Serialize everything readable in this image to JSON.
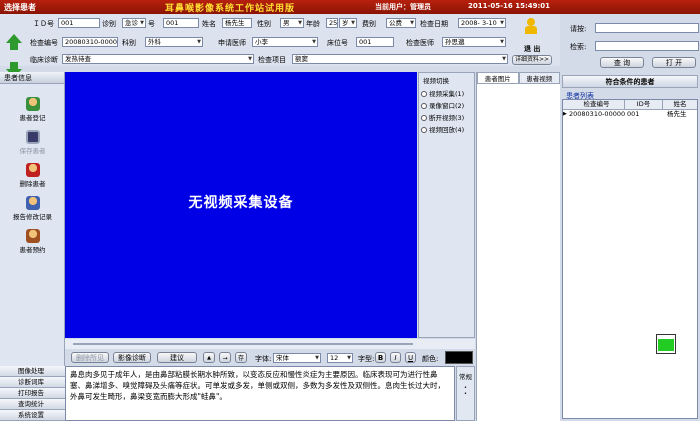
{
  "titlebar": {
    "left": "选择患者",
    "title": "耳鼻喉影像系统工作站试用版",
    "user": "当前用户：管理员",
    "datetime": "2011-05-16 15:49:01"
  },
  "form": {
    "id_label": "ＩＤ号",
    "id_value": "001",
    "visit_label": "诊别",
    "visit_value": "急诊",
    "no_label": "号",
    "no_value": "001",
    "name_label": "姓名",
    "name_value": "杨先生",
    "sex_label": "性别",
    "sex_value": "男",
    "age_label": "年龄",
    "age_value": "25",
    "age_unit": "岁",
    "fee_label": "费别",
    "fee_value": "公费",
    "date_label": "检查日期",
    "date_value": "2008- 3-10",
    "exam_no_label": "检查编号",
    "exam_no_value": "20080310-000001",
    "dept_label": "科别",
    "dept_value": "外科",
    "doctor_label": "申请医师",
    "doctor_value": "小李",
    "bed_label": "床位号",
    "bed_value": "001",
    "checker_label": "检查医师",
    "checker_value": "孙思邈",
    "clinical_label": "临床诊断",
    "clinical_value": "发热待查",
    "item_label": "检查项目",
    "item_value": "额窦"
  },
  "exit": {
    "label": "退 出",
    "detail": "详细资料>>"
  },
  "search": {
    "phone_label": "请按:",
    "check_label": "检索:",
    "query_btn": "查 询",
    "open_btn": "打 开",
    "result_title": "符合条件的患者",
    "list_label": "患者列表",
    "columns": [
      "检查编号",
      "ID号",
      "姓名"
    ],
    "rows": [
      [
        "20080310-000001",
        "001",
        "杨先生"
      ]
    ]
  },
  "leftnav": {
    "header": "患者信息",
    "items": [
      "患者登记",
      "保存患者",
      "删除患者",
      "报告修改记录",
      "患者预约"
    ]
  },
  "video": {
    "message": "无视频采集设备"
  },
  "vswitch": {
    "title": "视频切换",
    "options": [
      "视频采集(1)",
      "录像窗口(2)",
      "断开视频(3)",
      "视频回放(4)"
    ]
  },
  "middle_tabs": [
    "患者图片",
    "患者视频"
  ],
  "toolbar2": {
    "btn_all": "删除所见",
    "btn_diag": "影像诊断",
    "btn_suggest": "建议",
    "btn_save": "存",
    "font_label": "字体:",
    "font_value": "宋体",
    "size_value": "12",
    "size_label": "字型:",
    "bold": "B",
    "italic": "I",
    "underline": "U",
    "color_label": "颜色:"
  },
  "report_text": "鼻息肉多见于成年人，是由鼻部粘膜长期水肿所致，以变态反应和慢性炎症为主要原因。临床表现可为进行性鼻塞、鼻涕增多、嗅觉障碍及头痛等症状。可单发或多发，单侧或双侧，多数为多发性及双侧性。息肉生长过大时，外鼻可发生畸形，鼻梁变宽而膨大形成\"蛙鼻\"。",
  "sidevert": "常规",
  "bottomnav": [
    "图像处理",
    "诊断词库",
    "打印报告",
    "查询统计",
    "系统设置"
  ],
  "colors": {
    "titlebar": "#b8200e",
    "video": "#0000e6",
    "accent_green": "#2e9a2e"
  }
}
